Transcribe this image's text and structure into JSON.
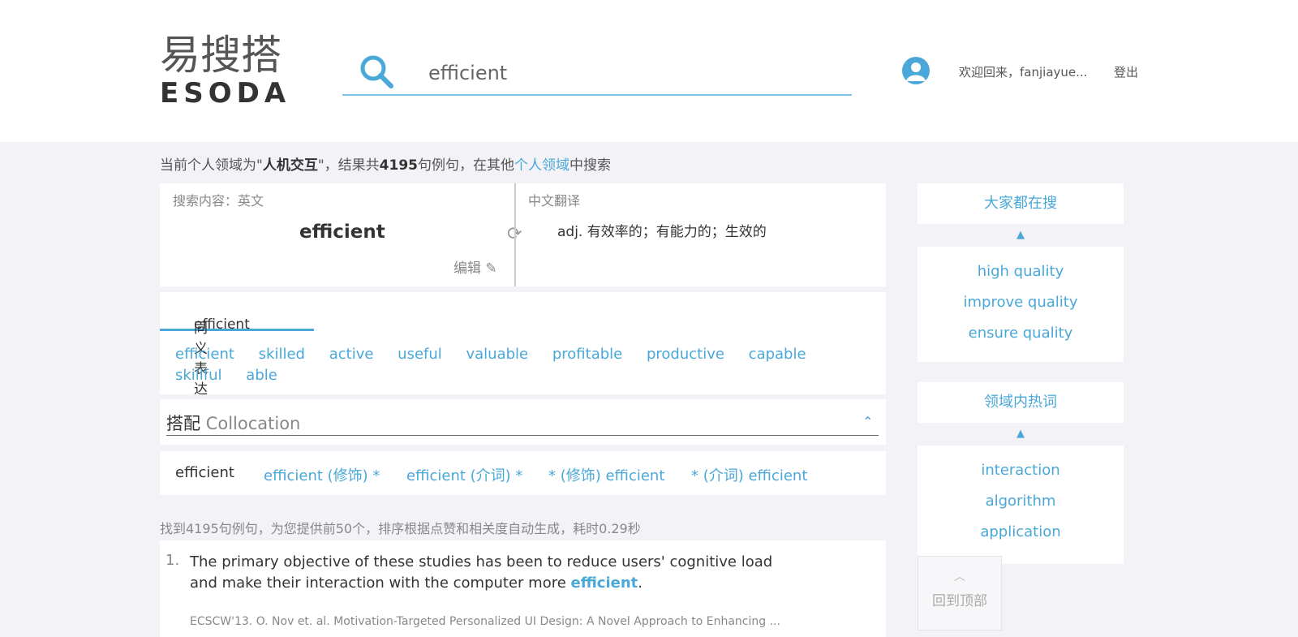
{
  "header": {
    "logo_cn": "易搜搭",
    "logo_en": "ESODA",
    "search_value": "efficient",
    "welcome": "欢迎回来，fanjiayue...",
    "logout": "登出"
  },
  "info": {
    "prefix": "当前个人领域为\"",
    "domain": "人机交互",
    "mid": "\"，结果共",
    "count": "4195",
    "mid2": "句例句，在其他",
    "link": "个人领域",
    "suffix": "中搜索"
  },
  "search_panel": {
    "label_left": "搜索内容：英文",
    "word": "efficient",
    "edit": "编辑",
    "label_right": "中文翻译",
    "translation": "adj. 有效率的；有能力的；生效的"
  },
  "synonyms": {
    "tab_word": "efficient",
    "tab_label": "同义表达",
    "items": [
      "efficient",
      "skilled",
      "active",
      "useful",
      "valuable",
      "profitable",
      "productive",
      "capable",
      "skillful",
      "able"
    ]
  },
  "collocation": {
    "title_cn": "搭配",
    "title_en": "Collocation",
    "tabs": [
      "efficient",
      "efficient (修饰) *",
      "efficient (介词) *",
      "* (修饰) efficient",
      "* (介词) efficient"
    ]
  },
  "found_text": "找到4195句例句，为您提供前50个，排序根据点赞和相关度自动生成，耗时0.29秒",
  "example": {
    "num": "1.",
    "text_before": "The primary objective of these studies has been to reduce users' cognitive load and make their interaction with the computer more ",
    "highlight": "efficient",
    "text_after": ".",
    "source": "ECSCW'13. O. Nov et. al. Motivation-Targeted Personalized UI Design: A Novel Approach to Enhancing ..."
  },
  "sidebar": {
    "popular_title": "大家都在搜",
    "popular_items": [
      "high quality",
      "improve quality",
      "ensure quality"
    ],
    "hot_title": "领域内热词",
    "hot_items": [
      "interaction",
      "algorithm",
      "application"
    ]
  },
  "back_to_top": "回到顶部",
  "colors": {
    "accent": "#4aa8d8",
    "background": "#f3f3f7"
  }
}
